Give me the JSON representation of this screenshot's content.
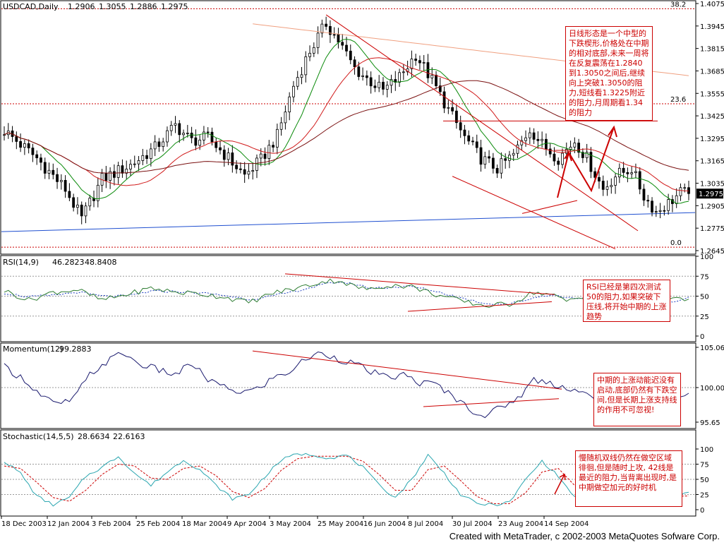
{
  "footer": "Created with MetaTrader, c 2002-2003 MetaQuotes Sofware Corp.",
  "colors": {
    "price": "#000000",
    "rsi": "#2e7d32",
    "rsi_signal": "#1f3fbf",
    "momentum": "#1a1a6e",
    "stoch_main": "#2aa6b0",
    "stoch_signal": "#cc0000",
    "trend": "#cc0000",
    "long_ma": "#1f4fd0"
  },
  "chart_data": [
    {
      "type": "candlestick",
      "title": "USDCAD,Daily",
      "ohlc_header": [
        "1.2906",
        "1.3055",
        "1.2886",
        "1.2975"
      ],
      "last_price": "1.2975",
      "ylim": [
        1.2645,
        1.4075
      ],
      "y_ticks": [
        "1.4075",
        "1.3945",
        "1.3815",
        "1.3685",
        "1.3555",
        "1.3425",
        "1.3295",
        "1.3165",
        "1.3035",
        "1.2905",
        "1.2775",
        "1.2645"
      ],
      "x_tick_labels": [
        "18 Dec 2003",
        "12 Jan 2004",
        "3 Feb 2004",
        "25 Feb 2004",
        "18 Mar 2004",
        "9 Apr 2004",
        "3 May 2004",
        "25 May 2004",
        "16 Jun 2004",
        "8 Jul 2004",
        "30 Jul 2004",
        "23 Aug 2004",
        "14 Sep 2004"
      ],
      "fib_levels": [
        {
          "label": "38.2",
          "value": 1.4045
        },
        {
          "label": "23.6",
          "value": 1.3495
        },
        {
          "label": "0.0",
          "value": 1.2665
        }
      ],
      "close_anchors": [
        [
          0,
          1.334
        ],
        [
          8,
          1.318
        ],
        [
          15,
          1.3
        ],
        [
          19,
          1.283
        ],
        [
          24,
          1.306
        ],
        [
          31,
          1.314
        ],
        [
          37,
          1.324
        ],
        [
          42,
          1.337
        ],
        [
          46,
          1.328
        ],
        [
          50,
          1.33
        ],
        [
          55,
          1.318
        ],
        [
          59,
          1.308
        ],
        [
          63,
          1.317
        ],
        [
          67,
          1.331
        ],
        [
          71,
          1.36
        ],
        [
          75,
          1.38
        ],
        [
          79,
          1.396
        ],
        [
          82,
          1.386
        ],
        [
          86,
          1.37
        ],
        [
          89,
          1.364
        ],
        [
          93,
          1.357
        ],
        [
          97,
          1.365
        ],
        [
          101,
          1.378
        ],
        [
          105,
          1.363
        ],
        [
          109,
          1.346
        ],
        [
          113,
          1.33
        ],
        [
          117,
          1.318
        ],
        [
          121,
          1.312
        ],
        [
          125,
          1.32
        ],
        [
          129,
          1.335
        ],
        [
          132,
          1.326
        ],
        [
          136,
          1.318
        ],
        [
          140,
          1.328
        ],
        [
          143,
          1.318
        ],
        [
          147,
          1.3
        ],
        [
          150,
          1.308
        ],
        [
          154,
          1.312
        ],
        [
          157,
          1.296
        ],
        [
          160,
          1.287
        ],
        [
          163,
          1.292
        ],
        [
          166,
          1.298
        ],
        [
          168,
          1.2975
        ]
      ]
    },
    {
      "type": "line",
      "title": "RSI(14,9)",
      "values_header": [
        "46.2823",
        "48.8408"
      ],
      "ylim": [
        0,
        100
      ],
      "y_ticks": [
        "100",
        "75",
        "50",
        "25",
        "0"
      ],
      "anchors": [
        [
          0,
          57
        ],
        [
          6,
          45
        ],
        [
          12,
          55
        ],
        [
          18,
          58
        ],
        [
          24,
          45
        ],
        [
          30,
          52
        ],
        [
          36,
          60
        ],
        [
          42,
          55
        ],
        [
          48,
          53
        ],
        [
          54,
          49
        ],
        [
          60,
          42
        ],
        [
          66,
          54
        ],
        [
          72,
          60
        ],
        [
          78,
          68
        ],
        [
          82,
          70
        ],
        [
          86,
          62
        ],
        [
          90,
          58
        ],
        [
          94,
          64
        ],
        [
          100,
          62
        ],
        [
          106,
          52
        ],
        [
          112,
          44
        ],
        [
          118,
          38
        ],
        [
          124,
          40
        ],
        [
          130,
          55
        ],
        [
          134,
          52
        ],
        [
          138,
          44
        ],
        [
          142,
          50
        ],
        [
          146,
          38
        ],
        [
          150,
          47
        ],
        [
          154,
          52
        ],
        [
          158,
          40
        ],
        [
          162,
          44
        ],
        [
          166,
          46
        ],
        [
          168,
          46
        ]
      ],
      "signal_anchors": [
        [
          0,
          54
        ],
        [
          6,
          49
        ],
        [
          12,
          51
        ],
        [
          18,
          55
        ],
        [
          24,
          50
        ],
        [
          30,
          50
        ],
        [
          36,
          56
        ],
        [
          42,
          56
        ],
        [
          48,
          54
        ],
        [
          54,
          51
        ],
        [
          60,
          46
        ],
        [
          66,
          50
        ],
        [
          72,
          57
        ],
        [
          78,
          64
        ],
        [
          82,
          68
        ],
        [
          86,
          65
        ],
        [
          90,
          60
        ],
        [
          94,
          61
        ],
        [
          100,
          62
        ],
        [
          106,
          56
        ],
        [
          112,
          48
        ],
        [
          118,
          41
        ],
        [
          124,
          40
        ],
        [
          130,
          48
        ],
        [
          134,
          52
        ],
        [
          138,
          48
        ],
        [
          142,
          48
        ],
        [
          146,
          42
        ],
        [
          150,
          44
        ],
        [
          154,
          49
        ],
        [
          158,
          44
        ],
        [
          162,
          43
        ],
        [
          166,
          45
        ],
        [
          168,
          48.8
        ]
      ]
    },
    {
      "type": "line",
      "title": "Momentum(12)",
      "values_header": [
        "99.2883"
      ],
      "ylim": [
        95.65,
        105.06
      ],
      "y_ticks": [
        "105.06",
        "100.00",
        "95.65"
      ],
      "anchors": [
        [
          0,
          102.6
        ],
        [
          5,
          101.0
        ],
        [
          9,
          99.0
        ],
        [
          13,
          97.8
        ],
        [
          17,
          98.6
        ],
        [
          21,
          101.6
        ],
        [
          25,
          103.2
        ],
        [
          29,
          104.4
        ],
        [
          33,
          103.0
        ],
        [
          38,
          102.2
        ],
        [
          42,
          101.6
        ],
        [
          46,
          103.0
        ],
        [
          50,
          101.0
        ],
        [
          54,
          100.0
        ],
        [
          58,
          99.4
        ],
        [
          62,
          99.8
        ],
        [
          66,
          101.2
        ],
        [
          70,
          102.0
        ],
        [
          74,
          103.6
        ],
        [
          78,
          104.4
        ],
        [
          82,
          103.6
        ],
        [
          86,
          103.0
        ],
        [
          90,
          102.0
        ],
        [
          94,
          101.2
        ],
        [
          98,
          101.6
        ],
        [
          102,
          100.6
        ],
        [
          106,
          100.4
        ],
        [
          110,
          99.0
        ],
        [
          114,
          97.4
        ],
        [
          118,
          96.4
        ],
        [
          122,
          97.6
        ],
        [
          126,
          98.6
        ],
        [
          130,
          101.0
        ],
        [
          134,
          100.6
        ],
        [
          138,
          100.0
        ],
        [
          142,
          99.4
        ],
        [
          146,
          98.0
        ],
        [
          150,
          99.6
        ],
        [
          154,
          99.8
        ],
        [
          158,
          99.0
        ],
        [
          162,
          98.8
        ],
        [
          166,
          99.0
        ],
        [
          168,
          99.3
        ]
      ]
    },
    {
      "type": "line",
      "title": "Stochastic(14,5,5)",
      "values_header": [
        "28.6634",
        "22.6163"
      ],
      "ylim": [
        0,
        100
      ],
      "y_ticks": [
        "100",
        "75",
        "50",
        "25",
        "0"
      ],
      "anchors": [
        [
          0,
          80
        ],
        [
          4,
          60
        ],
        [
          8,
          22
        ],
        [
          12,
          8
        ],
        [
          16,
          20
        ],
        [
          20,
          55
        ],
        [
          24,
          70
        ],
        [
          28,
          88
        ],
        [
          32,
          60
        ],
        [
          36,
          40
        ],
        [
          40,
          62
        ],
        [
          44,
          82
        ],
        [
          48,
          66
        ],
        [
          52,
          40
        ],
        [
          56,
          18
        ],
        [
          60,
          25
        ],
        [
          64,
          55
        ],
        [
          68,
          82
        ],
        [
          72,
          92
        ],
        [
          76,
          90
        ],
        [
          80,
          85
        ],
        [
          84,
          90
        ],
        [
          88,
          70
        ],
        [
          92,
          40
        ],
        [
          96,
          20
        ],
        [
          100,
          50
        ],
        [
          104,
          90
        ],
        [
          108,
          60
        ],
        [
          112,
          25
        ],
        [
          116,
          10
        ],
        [
          120,
          8
        ],
        [
          124,
          12
        ],
        [
          128,
          50
        ],
        [
          132,
          80
        ],
        [
          136,
          55
        ],
        [
          140,
          20
        ],
        [
          144,
          45
        ],
        [
          148,
          65
        ],
        [
          152,
          35
        ],
        [
          156,
          15
        ],
        [
          160,
          30
        ],
        [
          164,
          20
        ],
        [
          168,
          28.7
        ]
      ],
      "signal_anchors": [
        [
          0,
          72
        ],
        [
          4,
          68
        ],
        [
          8,
          45
        ],
        [
          12,
          20
        ],
        [
          16,
          14
        ],
        [
          20,
          32
        ],
        [
          24,
          58
        ],
        [
          28,
          75
        ],
        [
          32,
          72
        ],
        [
          36,
          52
        ],
        [
          40,
          50
        ],
        [
          44,
          68
        ],
        [
          48,
          72
        ],
        [
          52,
          56
        ],
        [
          56,
          30
        ],
        [
          60,
          20
        ],
        [
          64,
          35
        ],
        [
          68,
          65
        ],
        [
          72,
          84
        ],
        [
          76,
          88
        ],
        [
          80,
          88
        ],
        [
          84,
          88
        ],
        [
          88,
          80
        ],
        [
          92,
          58
        ],
        [
          96,
          32
        ],
        [
          100,
          32
        ],
        [
          104,
          66
        ],
        [
          108,
          72
        ],
        [
          112,
          48
        ],
        [
          116,
          22
        ],
        [
          120,
          10
        ],
        [
          124,
          10
        ],
        [
          128,
          28
        ],
        [
          132,
          62
        ],
        [
          136,
          68
        ],
        [
          140,
          40
        ],
        [
          144,
          30
        ],
        [
          148,
          50
        ],
        [
          152,
          50
        ],
        [
          156,
          30
        ],
        [
          160,
          20
        ],
        [
          164,
          22
        ],
        [
          168,
          22.6
        ]
      ]
    }
  ],
  "annotations": {
    "price": "日线形态是一个中型的下跌楔形,价格处在中期的相对底部,未来一周将在反复震荡在1.2840到1.3050之间后,继续向上突破1.3050的阻力,短线看1.3225附近的阻力,月周期看1.34的阻力",
    "rsi": "RSI已经是第四次测试50的阻力,如果突破下压线,将开始中期的上涨趋势",
    "momentum": "中期的上涨动能迟没有启动,底部仍然有下跌空间,但是长期上涨支持线的作用不可忽视!",
    "stochastic": "慢随机双线仍然在做空区域徘徊,但是随时上攻, 42线是最近的阻力,当背离出现时,是中期做空加元的好时机"
  }
}
